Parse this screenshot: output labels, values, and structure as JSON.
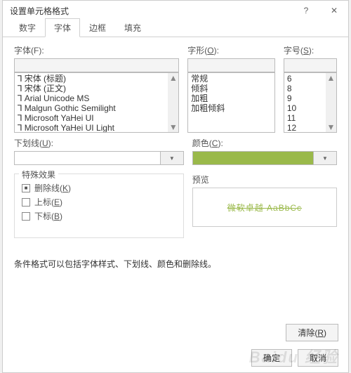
{
  "dialog": {
    "title": "设置单元格格式"
  },
  "tabs": {
    "t0": "数字",
    "t1": "字体",
    "t2": "边框",
    "t3": "填充",
    "activeIndex": 1
  },
  "labels": {
    "font": "字体(F):",
    "style_prefix": "字形(",
    "style_u": "O",
    "style_suffix": "):",
    "size_prefix": "字号(",
    "size_u": "S",
    "size_suffix": "):",
    "underline_prefix": "下划线(",
    "underline_u": "U",
    "underline_suffix": "):",
    "color_prefix": "颜色(",
    "color_u": "C",
    "color_suffix": "):",
    "effects": "特殊效果",
    "strike_prefix": "删除线(",
    "strike_u": "K",
    "strike_suffix": ")",
    "super_prefix": "上标(",
    "super_u": "E",
    "super_suffix": ")",
    "sub_prefix": "下标(",
    "sub_u": "B",
    "sub_suffix": ")",
    "preview": "预览",
    "clear_prefix": "清除(",
    "clear_u": "R",
    "clear_suffix": ")",
    "ok": "确定",
    "cancel": "取消"
  },
  "fontList": {
    "i0": "宋体 (标题)",
    "i1": "宋体 (正文)",
    "i2": "Arial Unicode MS",
    "i3": "Malgun Gothic Semilight",
    "i4": "Microsoft YaHei UI",
    "i5": "Microsoft YaHei UI Light"
  },
  "styleList": {
    "i0": "常规",
    "i1": "倾斜",
    "i2": "加粗",
    "i3": "加粗倾斜"
  },
  "sizeList": {
    "i0": "6",
    "i1": "8",
    "i2": "9",
    "i3": "10",
    "i4": "11",
    "i5": "12"
  },
  "preview": {
    "sample": "微软卓越 AaBbCc",
    "color": "#9ab94a"
  },
  "note": "条件格式可以包括字体样式、下划线、颜色和删除线。",
  "watermark": "Baidu 经验"
}
